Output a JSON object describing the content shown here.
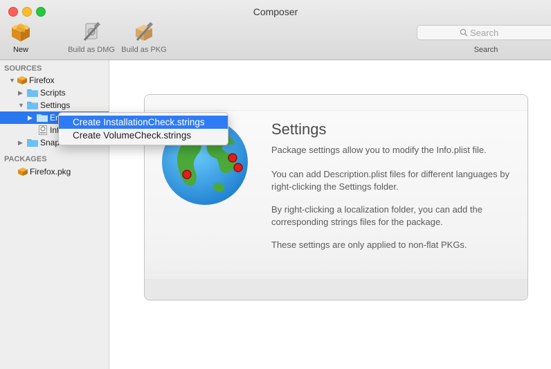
{
  "window": {
    "title": "Composer"
  },
  "toolbar": {
    "new_label": "New",
    "build_dmg_label": "Build as DMG",
    "build_pkg_label": "Build as PKG",
    "search_placeholder": "Search",
    "search_label": "Search"
  },
  "sidebar": {
    "sources_header": "SOURCES",
    "packages_header": "PACKAGES",
    "items": [
      {
        "label": "Firefox",
        "icon": "package-icon"
      },
      {
        "label": "Scripts",
        "icon": "folder-icon"
      },
      {
        "label": "Settings",
        "icon": "folder-icon"
      },
      {
        "label": "En",
        "icon": "folder-icon",
        "selected": true
      },
      {
        "label": "Inf",
        "icon": "plist-file-icon"
      },
      {
        "label": "Snap",
        "icon": "folder-icon"
      }
    ],
    "packages": [
      {
        "label": "Firefox.pkg",
        "icon": "package-icon"
      }
    ]
  },
  "context_menu": {
    "items": [
      {
        "label": "Create InstallationCheck.strings",
        "highlighted": true
      },
      {
        "label": "Create VolumeCheck.strings",
        "highlighted": false
      }
    ]
  },
  "main": {
    "title": "Settings",
    "paragraphs": [
      "Package settings allow you to modify the Info.plist file.",
      "You can add Description.plist files for different languages by right-clicking the Settings folder.",
      "By right-clicking a localization folder, you can add the corresponding strings files for the package.",
      "These settings are only applied to non-flat PKGs."
    ]
  },
  "colors": {
    "selection": "#2a78f0",
    "folder": "#5fb3ec",
    "ocean": "#2b8fd6",
    "land": "#49a83a",
    "pin": "#e0201b"
  }
}
